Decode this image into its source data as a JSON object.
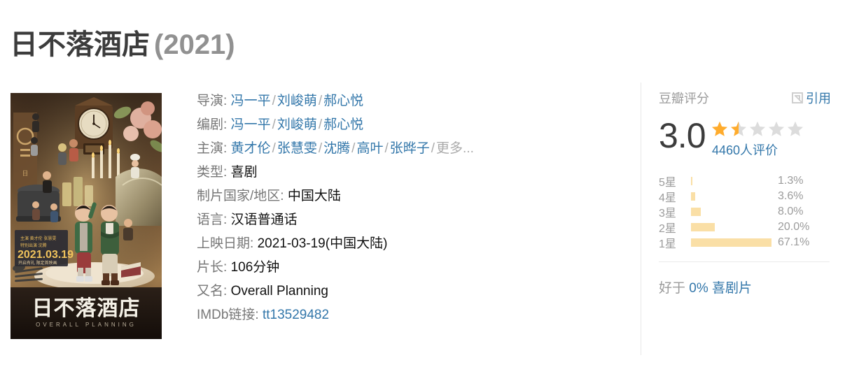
{
  "page": {
    "title_cn": "日不落酒店",
    "title_year": "(2021)"
  },
  "poster": {
    "alt": "日不落酒店 电影海报",
    "release_date_on_poster": "2021.03.19",
    "poster_title": "日不落酒店",
    "poster_subtitle": "OVERALL PLANNING",
    "poster_credits_line1": "黄才伦 张慧雯",
    "poster_credits_line2": "沈腾",
    "poster_tagline": "开启有礼 限定首映画"
  },
  "info": {
    "rows": [
      {
        "label": "导演:",
        "type": "links",
        "values": [
          "冯一平",
          "刘峻萌",
          "郝心悦"
        ],
        "more": null
      },
      {
        "label": "编剧:",
        "type": "links",
        "values": [
          "冯一平",
          "刘峻萌",
          "郝心悦"
        ],
        "more": null
      },
      {
        "label": "主演:",
        "type": "links",
        "values": [
          "黄才伦",
          "张慧雯",
          "沈腾",
          "高叶",
          "张晔子"
        ],
        "more": "更多..."
      },
      {
        "label": "类型:",
        "type": "text",
        "value": "喜剧"
      },
      {
        "label": "制片国家/地区:",
        "type": "text",
        "value": "中国大陆"
      },
      {
        "label": "语言:",
        "type": "text",
        "value": "汉语普通话"
      },
      {
        "label": "上映日期:",
        "type": "text",
        "value": "2021-03-19(中国大陆)"
      },
      {
        "label": "片长:",
        "type": "text",
        "value": "106分钟"
      },
      {
        "label": "又名:",
        "type": "text",
        "value": "Overall Planning"
      },
      {
        "label": "IMDb链接:",
        "type": "link",
        "value": "tt13529482"
      }
    ]
  },
  "rating": {
    "panel_label": "豆瓣评分",
    "quote_label": "引用",
    "quote_icon": "external-link-icon",
    "score": "3.0",
    "stars_filled": 1.5,
    "stars_total": 5,
    "votes_label": "4460人评价",
    "star_color": "#ffac2d",
    "star_empty_color": "#dcdcdc",
    "bar_color": "#fadfa6",
    "link_color": "#3377aa",
    "histogram": [
      {
        "label": "5星",
        "pct": "1.3%",
        "value": 1.3
      },
      {
        "label": "4星",
        "pct": "3.6%",
        "value": 3.6
      },
      {
        "label": "3星",
        "pct": "8.0%",
        "value": 8.0
      },
      {
        "label": "2星",
        "pct": "20.0%",
        "value": 20.0
      },
      {
        "label": "1星",
        "pct": "67.1%",
        "value": 67.1
      }
    ],
    "better_than": {
      "prefix": "好于",
      "percent": "0%",
      "category": "喜剧片"
    }
  }
}
